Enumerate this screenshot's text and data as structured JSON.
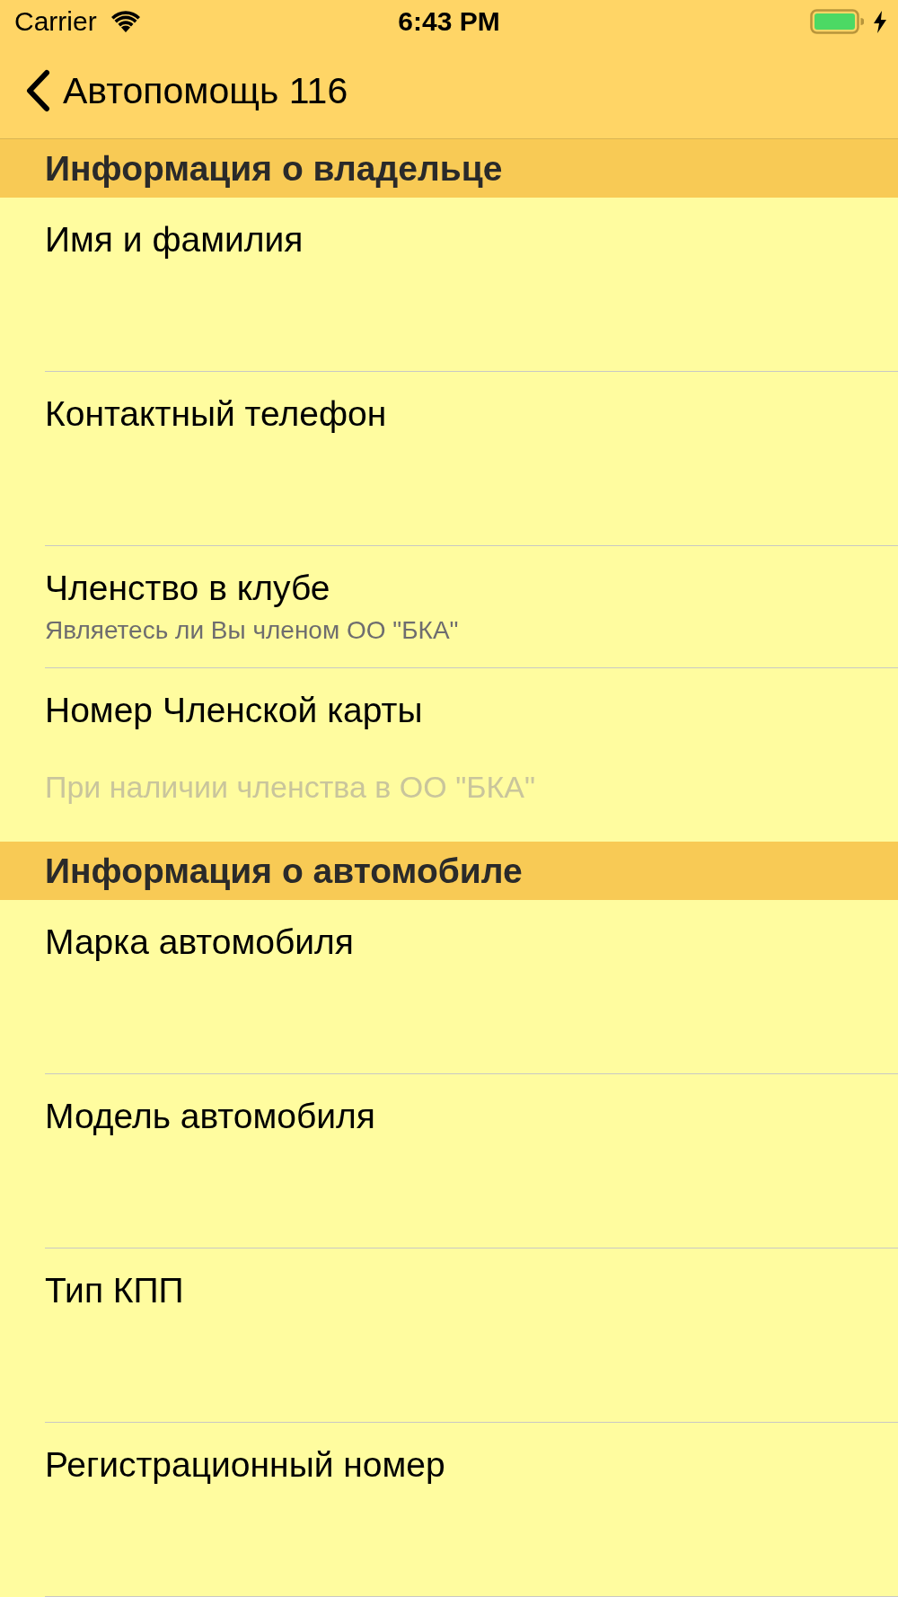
{
  "status_bar": {
    "carrier": "Carrier",
    "time": "6:43 PM"
  },
  "nav_bar": {
    "back_title": "Автопомощь 116"
  },
  "sections": [
    {
      "title": "Информация о владельце",
      "rows": [
        {
          "kind": "field",
          "label": "Имя и фамилия"
        },
        {
          "kind": "field",
          "label": "Контактный телефон"
        },
        {
          "kind": "detail",
          "label": "Членство в клубе",
          "subtitle": "Являетесь ли Вы членом ОО \"БКА\""
        },
        {
          "kind": "field",
          "label": "Номер Членской карты",
          "placeholder": "При наличии членства в ОО \"БКА\""
        }
      ]
    },
    {
      "title": "Информация о автомобиле",
      "rows": [
        {
          "kind": "field",
          "label": "Марка автомобиля"
        },
        {
          "kind": "field",
          "label": "Модель автомобиля"
        },
        {
          "kind": "field",
          "label": "Тип КПП"
        },
        {
          "kind": "field",
          "label": "Регистрационный номер"
        }
      ]
    }
  ]
}
